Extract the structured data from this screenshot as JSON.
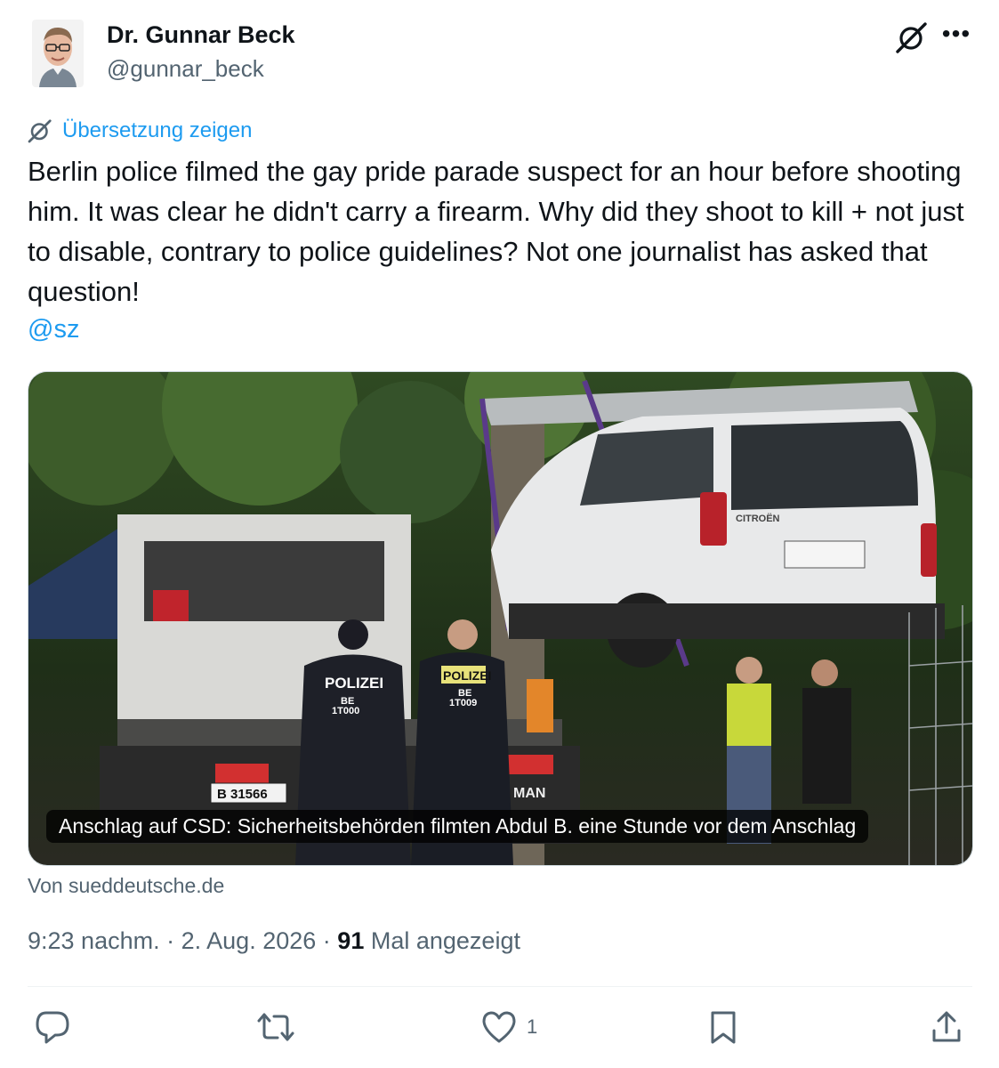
{
  "author": {
    "name": "Dr. Gunnar Beck",
    "handle": "@gunnar_beck",
    "avatar_icon": "profile-photo"
  },
  "header_actions": {
    "grok_icon": "grok-icon",
    "more_label": "•••"
  },
  "translate": {
    "icon": "grok-icon",
    "label": "Übersetzung zeigen"
  },
  "tweet": {
    "text": "Berlin police filmed the gay pride parade suspect for an hour before shooting him. It was clear he didn't carry a firearm. Why did they shoot to kill + not just to disable, contrary to police guidelines? Not one journalist has asked that question!",
    "mention": "@sz"
  },
  "card": {
    "caption": "Anschlag auf CSD: Sicherheitsbehörden filmten Abdul B. eine Stunde vor dem Anschlag",
    "source": "Von sueddeutsche.de",
    "photo_texts": {
      "police_1": "POLIZEI",
      "police_1_id_a": "BE",
      "police_1_id_b": "1T000",
      "police_2": "POLIZEI",
      "police_2_id_a": "BE",
      "police_2_id_b": "1T009",
      "plate": "B 31566",
      "van_brand": "CITROËN",
      "truck_brand": "MAN"
    }
  },
  "meta": {
    "time": "9:23 nachm.",
    "separator": "·",
    "date": "2. Aug. 2026",
    "views_count": "91",
    "views_label": "Mal angezeigt"
  },
  "actions": {
    "reply_icon": "reply-icon",
    "retweet_icon": "retweet-icon",
    "like_icon": "heart-icon",
    "like_count": "1",
    "bookmark_icon": "bookmark-icon",
    "share_icon": "share-icon"
  },
  "colors": {
    "link": "#1d9bf0",
    "text": "#0f1419",
    "muted": "#536471",
    "divider": "#eff3f4"
  }
}
